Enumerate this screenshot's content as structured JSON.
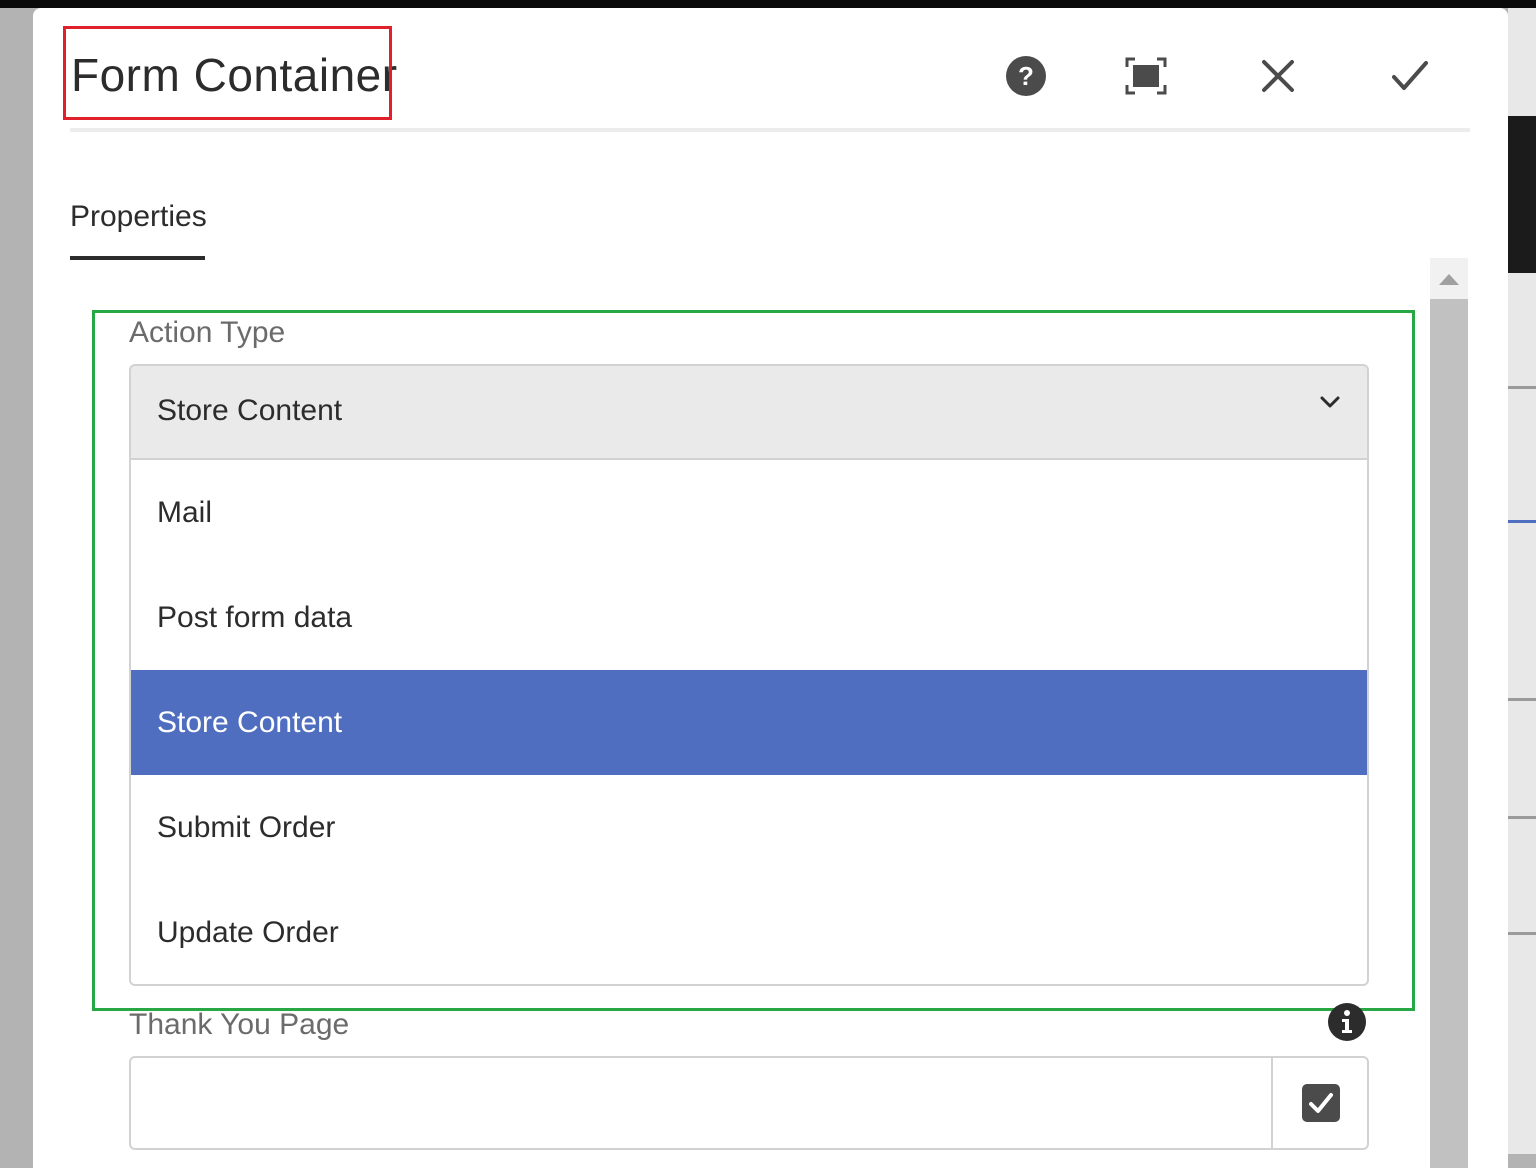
{
  "dialog": {
    "title": "Form Container",
    "actions": {
      "help": "help-icon",
      "fullscreen": "fullscreen-icon",
      "close": "close-icon",
      "done": "checkmark-icon"
    }
  },
  "tabs": [
    {
      "label": "Properties",
      "active": true
    }
  ],
  "action_type": {
    "label": "Action Type",
    "selected": "Store Content",
    "options": [
      "Mail",
      "Post form data",
      "Store Content",
      "Submit Order",
      "Update Order"
    ]
  },
  "thank_you_page": {
    "label": "Thank You Page",
    "value": ""
  },
  "colors": {
    "highlight": "#4f6ebf",
    "title_box": "#e0212b",
    "callout_box": "#28a745"
  }
}
